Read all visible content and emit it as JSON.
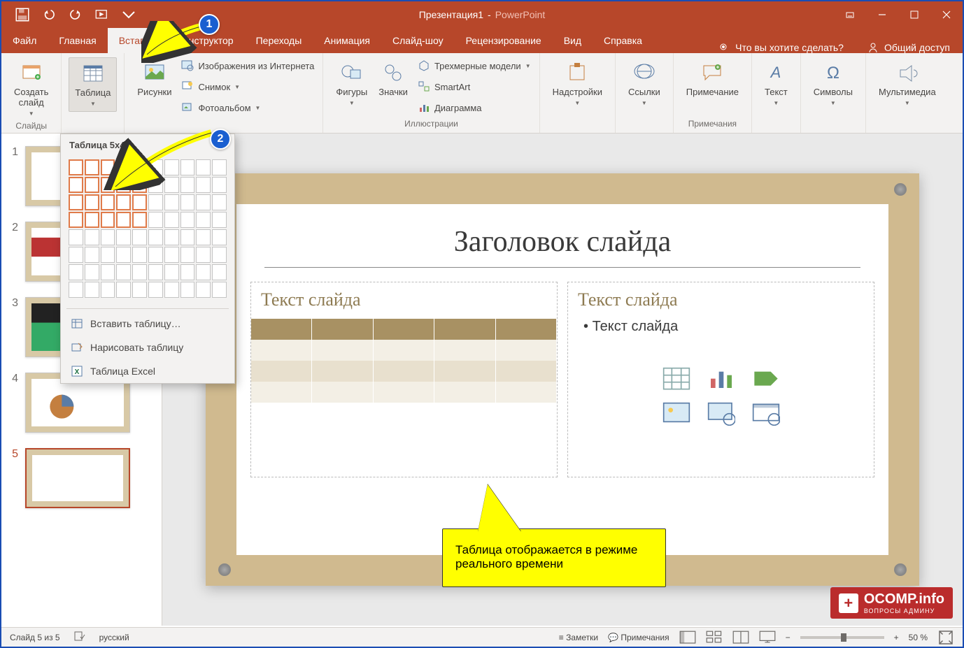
{
  "title": {
    "doc": "Презентация1",
    "sep": "-",
    "app": "PowerPoint"
  },
  "tabs": {
    "file": "Файл",
    "home": "Главная",
    "insert": "Вставка",
    "design": "Конструктор",
    "transitions": "Переходы",
    "animations": "Анимация",
    "slideshow": "Слайд-шоу",
    "review": "Рецензирование",
    "view": "Вид",
    "help": "Справка"
  },
  "tellme": "Что вы хотите сделать?",
  "share": "Общий доступ",
  "ribbon": {
    "slides": {
      "new": "Создать\nслайд",
      "label": "Слайды"
    },
    "tables": {
      "btn": "Таблица"
    },
    "images": {
      "pictures": "Рисунки",
      "online": "Изображения из Интернета",
      "screenshot": "Снимок",
      "album": "Фотоальбом"
    },
    "illus": {
      "shapes": "Фигуры",
      "icons": "Значки",
      "3d": "Трехмерные модели",
      "smartart": "SmartArt",
      "chart": "Диаграмма",
      "label": "Иллюстрации"
    },
    "addins": "Надстройки",
    "links": "Ссылки",
    "comment": "Примечание",
    "comment_label": "Примечания",
    "text": "Текст",
    "symbols": "Символы",
    "media": "Мультимедиа"
  },
  "table_menu": {
    "title": "Таблица 5x4",
    "insert": "Вставить таблицу…",
    "draw": "Нарисовать таблицу",
    "excel": "Таблица Excel",
    "rows": 4,
    "cols": 5
  },
  "slide": {
    "title": "Заголовок слайда",
    "left_label": "Текст слайда",
    "right_label": "Текст слайда",
    "bullet": "Текст слайда"
  },
  "callout": "Таблица отображается в режиме реального времени",
  "thumbs": [
    "1",
    "2",
    "3",
    "4",
    "5"
  ],
  "status": {
    "slide": "Слайд 5 из 5",
    "lang": "русский",
    "notes": "Заметки",
    "comments": "Примечания",
    "zoom": "50 %"
  },
  "watermark": {
    "main": "OCOMP.info",
    "sub": "ВОПРОСЫ АДМИНУ"
  }
}
